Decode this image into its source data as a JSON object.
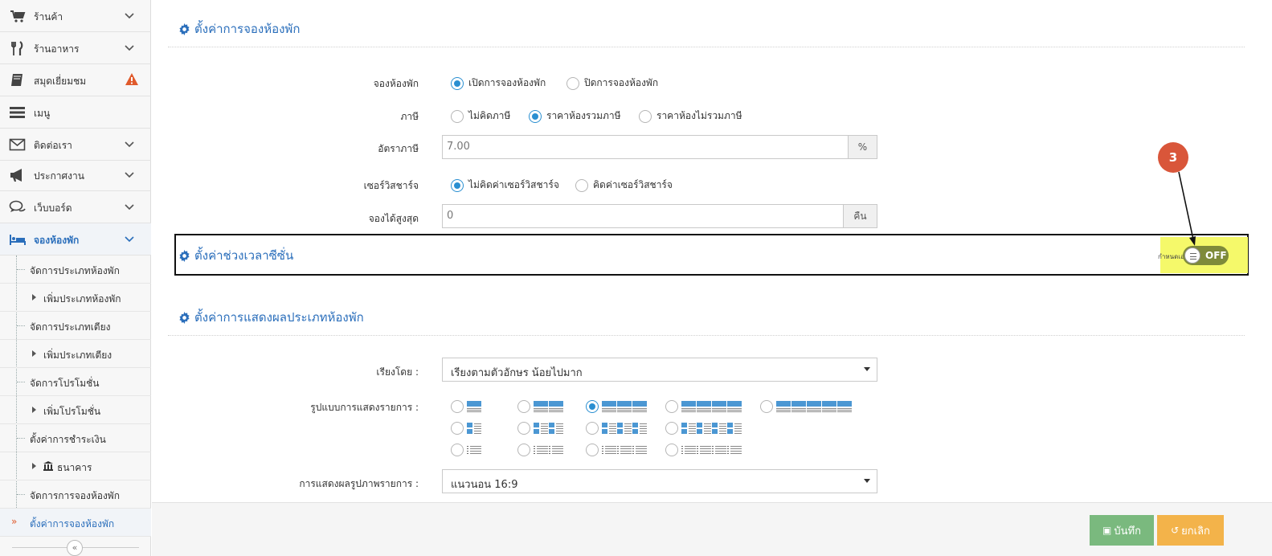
{
  "sidebar": {
    "menu": [
      {
        "label": "ร้านค้า",
        "icon": "cart-icon",
        "has_chevron": true
      },
      {
        "label": "ร้านอาหาร",
        "icon": "fork-knife-icon",
        "has_chevron": true
      },
      {
        "label": "สมุดเยี่ยมชม",
        "icon": "book-icon",
        "has_warning": true
      },
      {
        "label": "เมนู",
        "icon": "menu-list-icon"
      },
      {
        "label": "ติดต่อเรา",
        "icon": "envelope-icon",
        "has_chevron": true
      },
      {
        "label": "ประกาศงาน",
        "icon": "megaphone-icon",
        "has_chevron": true
      },
      {
        "label": "เว็บบอร์ด",
        "icon": "chat-bubbles-icon",
        "has_chevron": true
      },
      {
        "label": "จองห้องพัก",
        "icon": "bed-icon",
        "has_chevron": true,
        "active": true
      }
    ],
    "submenu": [
      {
        "label": "จัดการประเภทห้องพัก",
        "child": false
      },
      {
        "label": "เพิ่มประเภทห้องพัก",
        "child": true
      },
      {
        "label": "จัดการประเภทเตียง",
        "child": false
      },
      {
        "label": "เพิ่มประเภทเตียง",
        "child": true
      },
      {
        "label": "จัดการโปรโมชั่น",
        "child": false
      },
      {
        "label": "เพิ่มโปรโมชั่น",
        "child": true
      },
      {
        "label": "ตั้งค่าการชำระเงิน",
        "child": false
      },
      {
        "label": "ธนาคาร",
        "child": true,
        "icon": "bank-icon"
      },
      {
        "label": "จัดการการจองห้องพัก",
        "child": false
      },
      {
        "label": "ตั้งค่าการจองห้องพัก",
        "child": false,
        "current": true
      }
    ],
    "current_marker": "»",
    "collapse_symbol": "«"
  },
  "booking_section": {
    "title": "ตั้งค่าการจองห้องพัก",
    "booking_label": "จองห้องพัก",
    "booking_options": [
      "เปิดการจองห้องพัก",
      "ปิดการจองห้องพัก"
    ],
    "booking_selected": 0,
    "tax_label": "ภาษี",
    "tax_options": [
      "ไม่คิดภาษี",
      "ราคาห้องรวมภาษี",
      "ราคาห้องไม่รวมภาษี"
    ],
    "tax_selected": 1,
    "tax_rate_label": "อัตราภาษี",
    "tax_rate_value": "7.00",
    "tax_rate_unit": "%",
    "service_label": "เซอร์วิสชาร์จ",
    "service_options": [
      "ไม่คิดค่าเซอร์วิสชาร์จ",
      "คิดค่าเซอร์วิสชาร์จ"
    ],
    "service_selected": 0,
    "max_nights_label": "จองได้สูงสุด",
    "max_nights_value": "0",
    "max_nights_unit": "คืน"
  },
  "season_section": {
    "title": "ตั้งค่าช่วงเวลาซีซั่น",
    "custom_label": "กำหนดเอง :",
    "toggle_text": "OFF",
    "toggle_on": false,
    "annotation_number": "3"
  },
  "display_section": {
    "title": "ตั้งค่าการแสดงผลประเภทห้องพัก",
    "sort_label": "เรียงโดย :",
    "sort_value": "เรียงตามตัวอักษร น้อยไปมาก",
    "layout_label": "รูปแบบการแสดงรายการ :",
    "layout_selected": "grid-3",
    "image_label": "การแสดงผลรูปภาพรายการ :",
    "image_value": "แนวนอน 16:9"
  },
  "footer": {
    "save_label": "บันทึก",
    "cancel_label": "ยกเลิก"
  },
  "colors": {
    "accent": "#2a6ebb",
    "save": "#7ab97e",
    "cancel": "#f3b34a",
    "highlight": "#f5f96a",
    "annotation": "#d9563a",
    "warning": "#e05a2b"
  }
}
